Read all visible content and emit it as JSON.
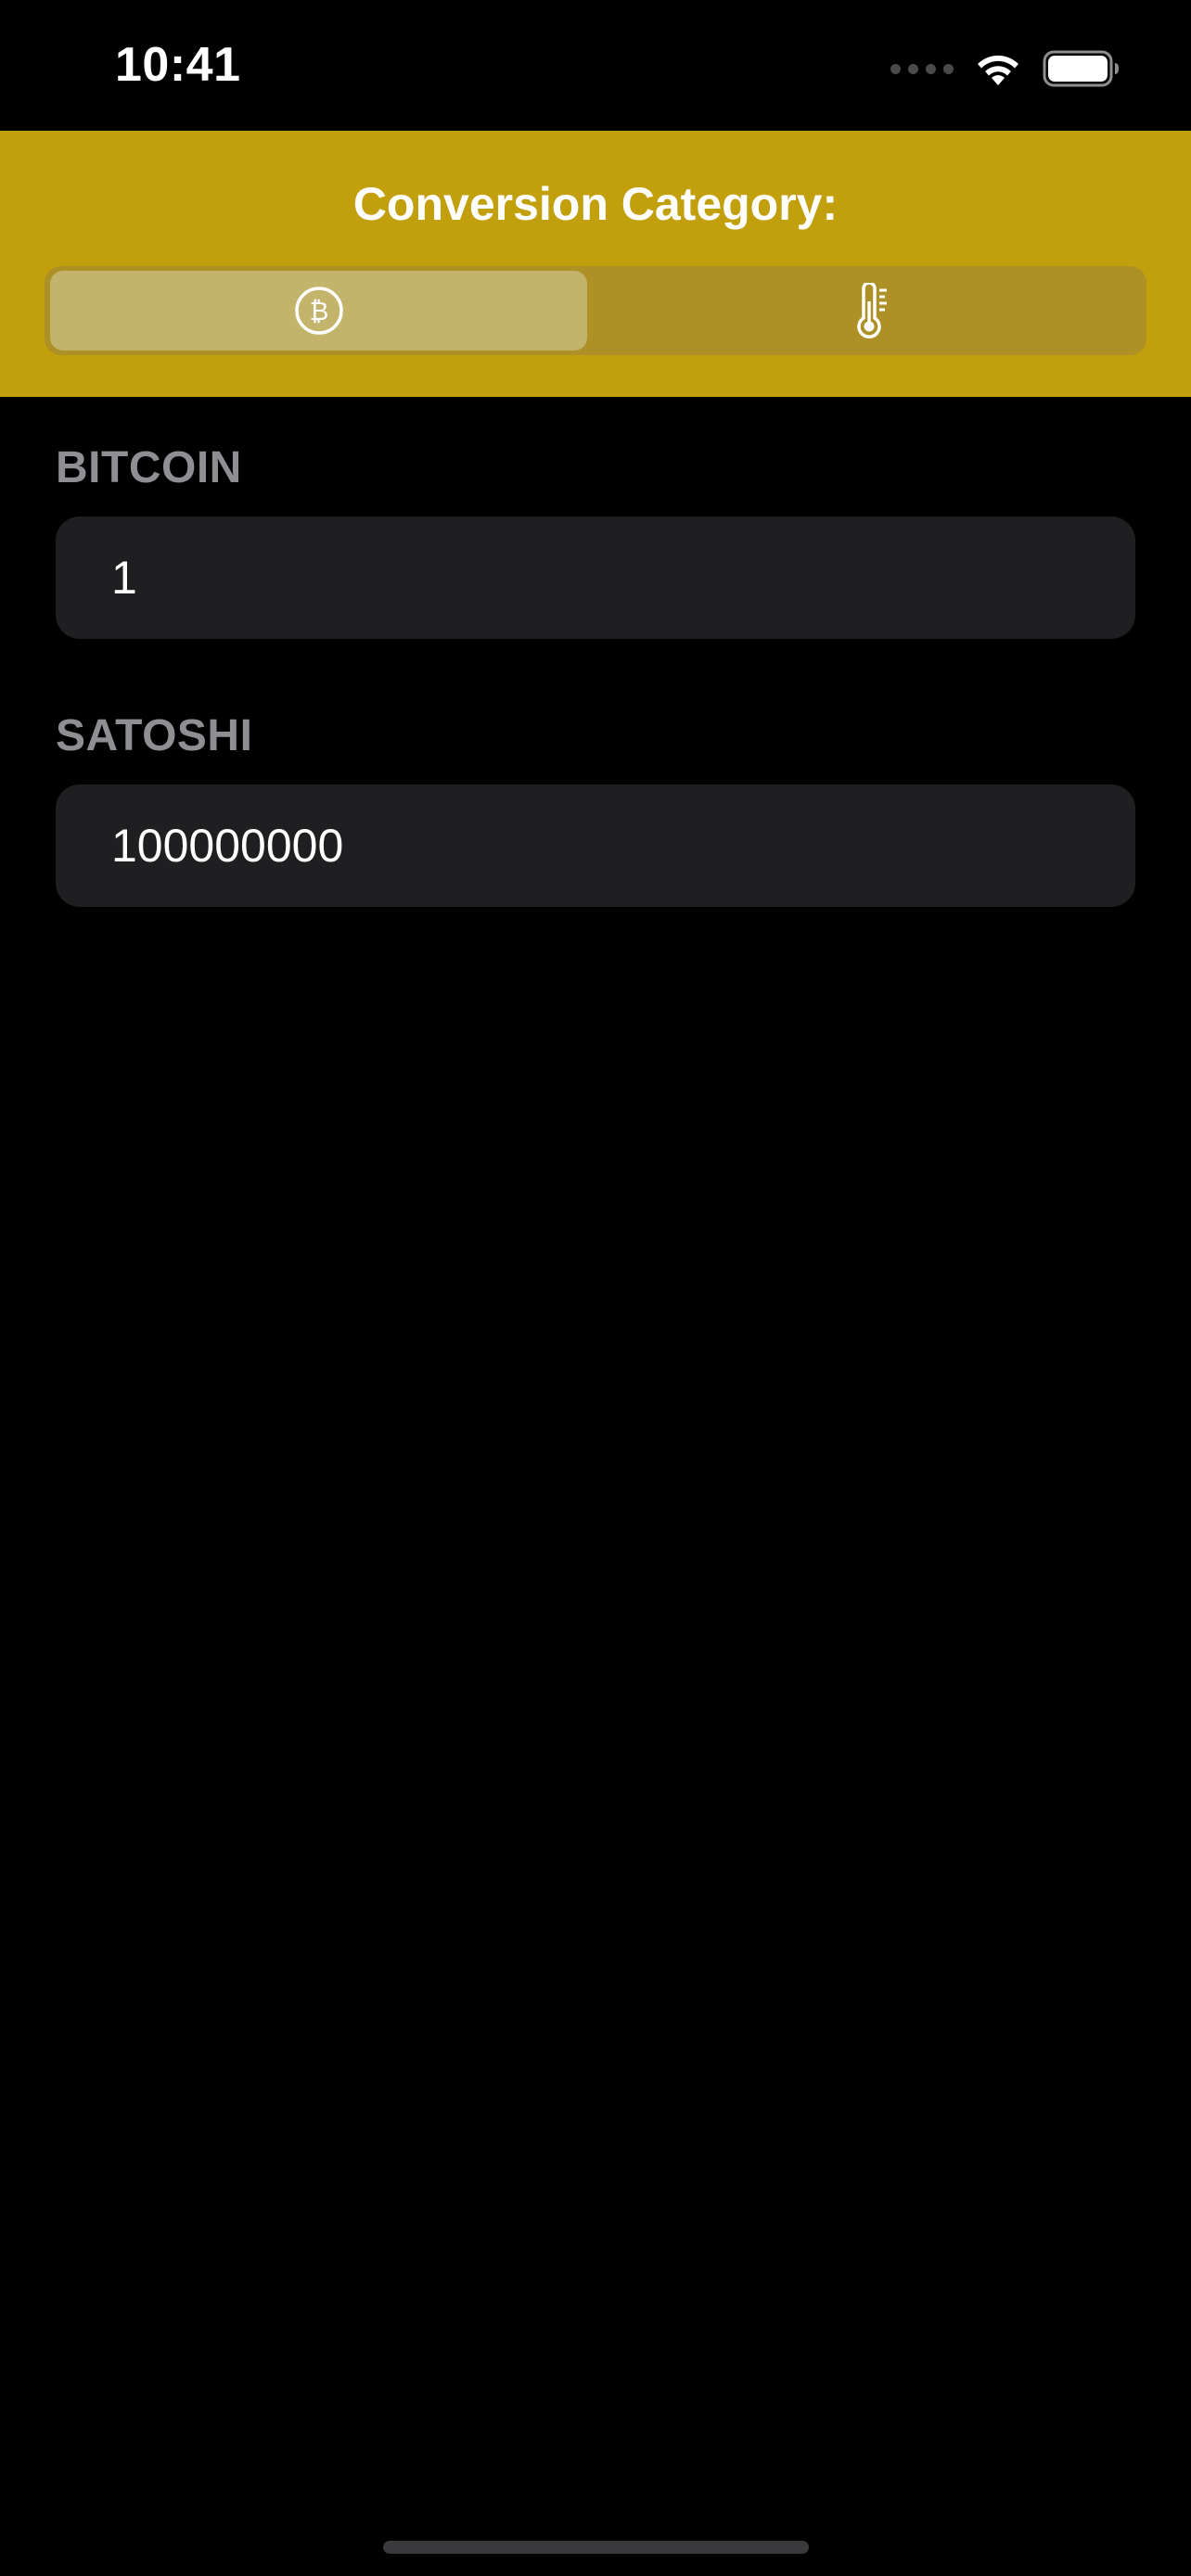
{
  "status_bar": {
    "time": "10:41",
    "icons": [
      "cellular-signal-icon",
      "wifi-icon",
      "battery-icon"
    ]
  },
  "header": {
    "title": "Conversion Category:",
    "segments": [
      {
        "icon": "bitcoin-icon",
        "selected": true
      },
      {
        "icon": "thermometer-icon",
        "selected": false
      }
    ]
  },
  "fields": [
    {
      "label": "BITCOIN",
      "value": "1"
    },
    {
      "label": "SATOSHI",
      "value": "100000000"
    }
  ],
  "colors": {
    "header_bg": "#c29f0c",
    "segment_track": "#ad9127",
    "segment_selected": "#c2b46a",
    "field_bg": "#1f1f21",
    "label_color": "#8e8e93",
    "background": "#000000"
  }
}
